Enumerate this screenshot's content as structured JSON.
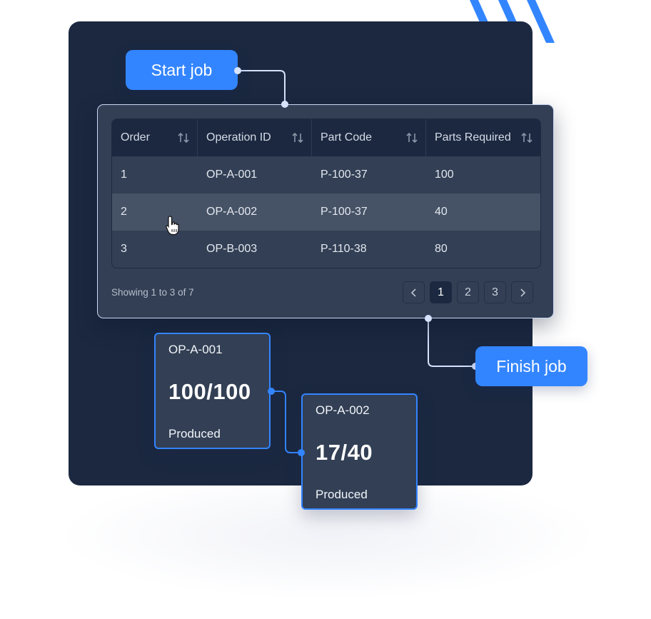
{
  "buttons": {
    "start_job": "Start job",
    "finish_job": "Finish job"
  },
  "table": {
    "columns": [
      {
        "label": "Order",
        "sort_icon": "sort-arrows-icon"
      },
      {
        "label": "Operation ID",
        "sort_icon": "sort-arrows-icon"
      },
      {
        "label": "Part Code",
        "sort_icon": "sort-arrows-icon"
      },
      {
        "label": "Parts Required",
        "sort_icon": "sort-arrows-icon"
      }
    ],
    "rows": [
      {
        "order": "1",
        "operation_id": "OP-A-001",
        "part_code": "P-100-37",
        "parts_required": "100"
      },
      {
        "order": "2",
        "operation_id": "OP-A-002",
        "part_code": "P-100-37",
        "parts_required": "40",
        "hovered": true
      },
      {
        "order": "3",
        "operation_id": "OP-B-003",
        "part_code": "P-110-38",
        "parts_required": "80"
      }
    ]
  },
  "pagination": {
    "summary": "Showing 1 to 3 of 7",
    "prev_icon": "chevron-left-icon",
    "next_icon": "chevron-right-icon",
    "pages": [
      "1",
      "2",
      "3"
    ],
    "current_page": "1"
  },
  "cards": [
    {
      "operation_id": "OP-A-001",
      "progress": "100/100",
      "produced": 100,
      "required": 100,
      "label": "Produced"
    },
    {
      "operation_id": "OP-A-002",
      "progress": "17/40",
      "produced": 17,
      "required": 40,
      "label": "Produced"
    }
  ],
  "colors": {
    "accent": "#3385ff",
    "backdrop": "#1b2840",
    "panel": "#323f54",
    "row_hover": "#465265",
    "connector_light": "#d6e3ff"
  }
}
